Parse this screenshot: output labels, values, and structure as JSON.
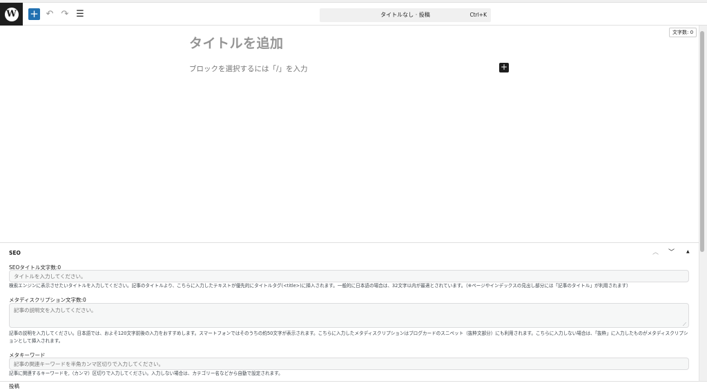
{
  "header": {
    "logo_letter": "W",
    "add_label": "+",
    "undo_icon": "↶",
    "redo_icon": "↷",
    "list_view_icon": "☰",
    "command_title": "タイトルなし · 投稿",
    "command_shortcut": "Ctrl+K"
  },
  "canvas": {
    "word_count": "文字数: 0",
    "title_placeholder": "タイトルを追加",
    "block_placeholder": "ブロックを選択するには「/」を入力",
    "inserter_label": "+"
  },
  "seo": {
    "title": "SEO",
    "controls": {
      "up": "︿",
      "down": "﹀",
      "toggle": "▲"
    },
    "seo_title": {
      "label": "SEOタイトル文字数:0",
      "placeholder": "タイトルを入力してください。",
      "description": "検索エンジンに表示させたいタイトルを入力してください。記事のタイトルより、こちらに入力したテキストが優先的にタイトルタグ(<title>)に挿入されます。一般的に日本語の場合は、32文字以内が最適とされています。（※ページやインデックスの見出し部分には「記事のタイトル」が利用されます）"
    },
    "meta_description": {
      "label": "メタディスクリプション文字数:0",
      "placeholder": "記事の説明文を入力してください。",
      "description": "記事の説明を入力してください。日本語では、およそ120文字前後の入力をおすすめします。スマートフォンではそのうちの約50文字が表示されます。こちらに入力したメタディスクリプションはブログカードのスニペット（抜粋文部分）にも利用されます。こちらに入力しない場合は、「抜粋」に入力したものがメタディスクリプションとして挿入されます。"
    },
    "meta_keywords": {
      "label": "メタキーワード",
      "placeholder": "記事の関連キーワードを半角カンマ区切りで入力してください。",
      "description": "記事に関連するキーワードを,（カンマ）区切りで入力してください。入力しない場合は、カテゴリー名などから自動で設定されます。"
    }
  },
  "footer": {
    "breadcrumb": "投稿"
  }
}
